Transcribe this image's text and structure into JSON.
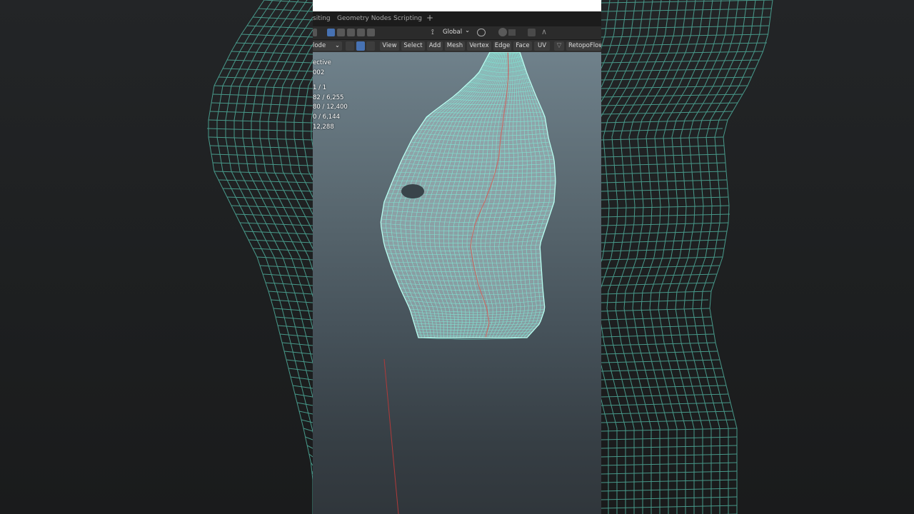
{
  "workspace_tabs": [
    "siting",
    "Geometry Nodes",
    "Scripting",
    "+"
  ],
  "toolbar": {
    "transform_orientation": "Global",
    "chevron": "⌄"
  },
  "header": {
    "mode_label": "lode",
    "menus": [
      "View",
      "Select",
      "Add",
      "Mesh",
      "Vertex",
      "Edge",
      "Face",
      "UV"
    ],
    "addon_label": "RetopoFlow"
  },
  "overlay_stats": {
    "view_name": "ective",
    "object_name": "002",
    "objects": "1 / 1",
    "vertices": "82 / 6,255",
    "edges": "80 / 12,400",
    "faces": "0 / 6,144",
    "triangles": "12,288"
  },
  "colors": {
    "wire": "#7fe6d4",
    "wire_dim": "#5fbfae",
    "side_wire": "#4fae9c",
    "mesh_fill": "#9db4b8",
    "seam": "#c56d68",
    "accent": "#4772b3"
  },
  "icons": [
    "select-box-icon",
    "transform-pivot-icon",
    "snap-icon",
    "proportional-edit-icon",
    "falloff-icon",
    "retopoflow-icon"
  ]
}
